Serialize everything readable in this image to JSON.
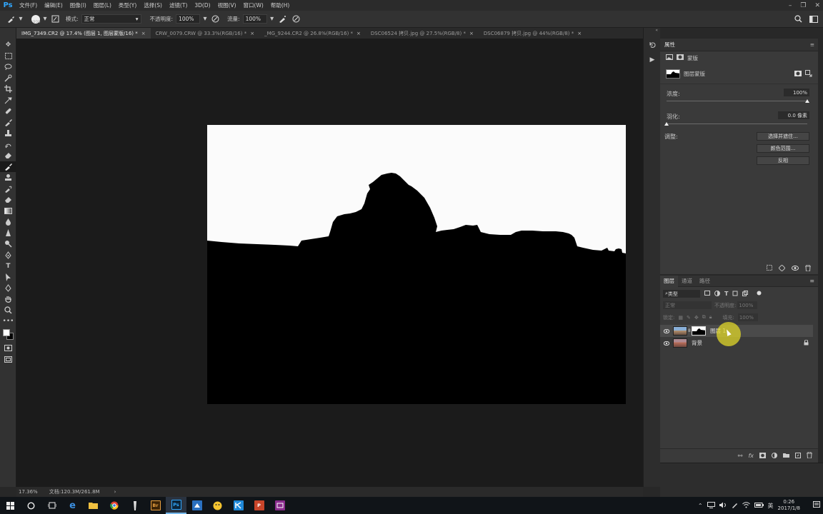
{
  "app": {
    "logo": "Ps",
    "menu": [
      "文件(F)",
      "编辑(E)",
      "图像(I)",
      "图层(L)",
      "类型(Y)",
      "选择(S)",
      "滤镜(T)",
      "3D(D)",
      "视图(V)",
      "窗口(W)",
      "帮助(H)"
    ],
    "window_controls": [
      "–",
      "❐",
      "✕"
    ]
  },
  "options": {
    "brush_size": "900",
    "mode_label": "模式:",
    "mode_value": "正常",
    "opacity_label": "不透明度:",
    "opacity_value": "100%",
    "flow_label": "流量:",
    "flow_value": "100%"
  },
  "tabs": [
    {
      "title": "IMG_7349.CR2 @ 17.4% (图层 1, 图层蒙版/16) *",
      "close": "×"
    },
    {
      "title": "CRW_0079.CRW @ 33.3%(RGB/16) *",
      "close": "×"
    },
    {
      "title": "_MG_9244.CR2 @ 26.8%(RGB/16) *",
      "close": "×"
    },
    {
      "title": "DSC06524 拷贝.jpg @ 27.5%(RGB/8) *",
      "close": "×"
    },
    {
      "title": "DSC06879 拷贝.jpg @ 44%(RGB/8) *",
      "close": "×"
    }
  ],
  "properties": {
    "title": "属性",
    "mask_type": "蒙版",
    "layer_mask": "图层蒙版",
    "density_label": "浓度:",
    "density_value": "100%",
    "density_level": 1.0,
    "feather_label": "羽化:",
    "feather_value": "0.0 像素",
    "feather_level": 0.0,
    "adjust_label": "调整:",
    "buttons": [
      "选择并遮住...",
      "颜色范围...",
      "反相"
    ]
  },
  "layers_panel": {
    "tabs": [
      "图层",
      "通道",
      "路径"
    ],
    "filter_label": "类型",
    "blend_mode": "正常",
    "opacity_label": "不透明度:",
    "opacity_value": "100%",
    "lock_label": "锁定:",
    "fill_label": "填充:",
    "fill_value": "100%",
    "layers": [
      {
        "name": "图层 1",
        "selected": true,
        "has_mask": true
      },
      {
        "name": "背景",
        "selected": false,
        "locked": true
      }
    ]
  },
  "status": {
    "zoom": "17.36%",
    "doc_info": "文档:120.3M/261.8M",
    "arrow": "›"
  },
  "taskbar": {
    "time": "0:26",
    "date": "2017/1/8",
    "ime": "英",
    "apps": [
      "windows-start",
      "cortana",
      "task-view",
      "edge",
      "file-explorer",
      "chrome",
      "app-blade",
      "bridge",
      "photoshop",
      "app-blue",
      "app-yellow",
      "app-k",
      "powerpoint",
      "app-purple"
    ],
    "bridge_label": "Br",
    "ps_label": "Ps",
    "ppt_label": "P"
  },
  "colors": {
    "ps_blue": "#31a8ff",
    "canvas_bg": "#1b1b1b",
    "panel_bg": "#3a3a3a",
    "cursor_highlight": "#e6dc28"
  }
}
